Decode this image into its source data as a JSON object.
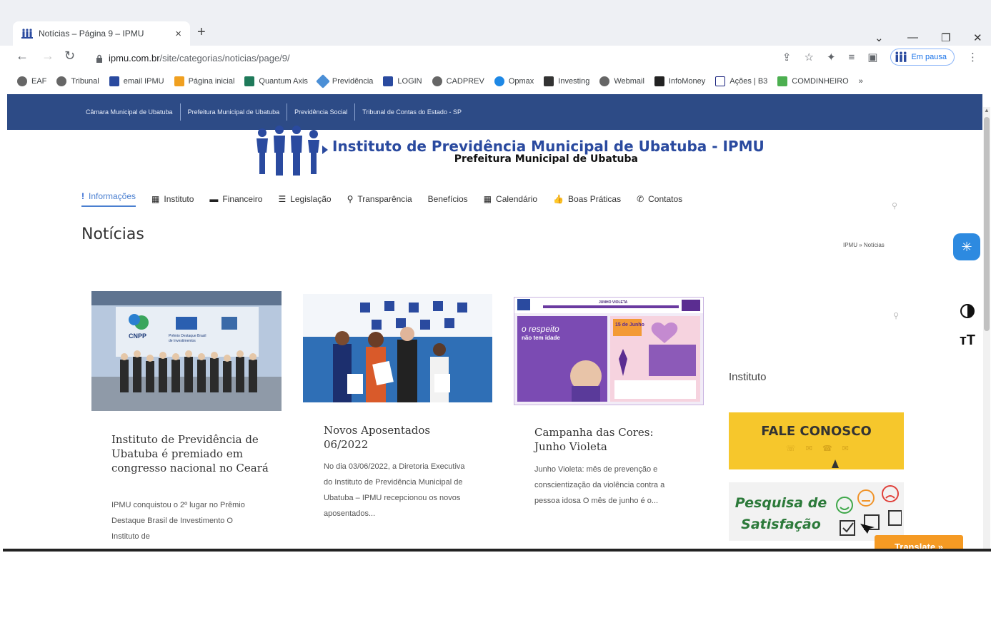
{
  "browser": {
    "tab_title": "Notícias – Página 9 – IPMU",
    "tab_close": "×",
    "new_tab": "+",
    "url_host": "ipmu.com.br",
    "url_path": "/site/categorias/noticias/page/9/",
    "paused_label": "Em pausa",
    "bookmarks": [
      "EAF",
      "Tribunal",
      "email IPMU",
      "Página inicial",
      "Quantum Axis",
      "Previdência",
      "LOGIN",
      "CADPREV",
      "Opmax",
      "Investing",
      "Webmail",
      "InfoMoney",
      "Ações | B3",
      "COMDINHEIRO"
    ],
    "bookmarks_more": "»"
  },
  "topstrip": {
    "links": [
      "Câmara Municipal de Ubatuba",
      "Prefeitura Municipal de Ubatuba",
      "Previdência Social",
      "Tribunal de Contas do Estado - SP"
    ]
  },
  "header": {
    "title": "Instituto de Previdência Municipal de Ubatuba - IPMU",
    "subtitle": "Prefeitura Municipal de Ubatuba"
  },
  "nav": {
    "items": [
      {
        "label": "Informações",
        "icon": "!"
      },
      {
        "label": "Instituto",
        "icon": "▦"
      },
      {
        "label": "Financeiro",
        "icon": "▬"
      },
      {
        "label": "Legislação",
        "icon": "☰"
      },
      {
        "label": "Transparência",
        "icon": "⚲"
      },
      {
        "label": "Benefícios",
        "icon": ""
      },
      {
        "label": "Calendário",
        "icon": "▦"
      },
      {
        "label": "Boas Práticas",
        "icon": "👍"
      },
      {
        "label": "Contatos",
        "icon": "✆"
      }
    ]
  },
  "page": {
    "title": "Notícias",
    "breadcrumb": "IPMU » Notícias"
  },
  "cards": [
    {
      "title": "Instituto de Previdência de Ubatuba é premiado em congresso nacional no Ceará",
      "excerpt": "IPMU conquistou o 2º lugar no Prêmio Destaque Brasil de Investimento O Instituto de"
    },
    {
      "title": "Novos Aposentados 06/2022",
      "excerpt": "No dia 03/06/2022, a Diretoria Executiva do Instituto de Previdência Municipal de Ubatuba – IPMU recepcionou os novos aposentados..."
    },
    {
      "title": "Campanha das Cores: Junho Violeta",
      "excerpt": "Junho Violeta: mês de prevenção e conscientização da violência contra a pessoa idosa O mês de junho é o..."
    }
  ],
  "card_images": {
    "cnpp": "CNPP",
    "banner_line1": "Prêmio Destaque Brasil",
    "banner_line2": "de Investimentos",
    "violeta_top": "JUNHO VIOLETA",
    "violeta_respeito": "o respeito",
    "violeta_idade": "não tem idade",
    "violeta_date": "15 de Junho"
  },
  "sidebar": {
    "heading": "Instituto",
    "fale": "FALE CONOSCO",
    "pesquisa_line1": "Pesquisa de",
    "pesquisa_line2": "Satisfação"
  },
  "translate_label": "Translate »",
  "colors": {
    "strip": "#2d4b86",
    "accent": "#4a7fd0",
    "fale": "#f6c72c",
    "translate": "#f59a23"
  }
}
